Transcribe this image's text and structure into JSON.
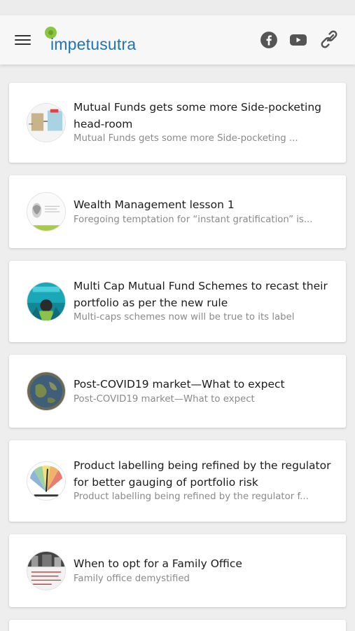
{
  "app": {
    "brand": "impetusutra",
    "icons": [
      "menu-icon",
      "facebook-icon",
      "youtube-icon",
      "link-icon"
    ],
    "brand_color": "#1f74b5",
    "logo_dot_color": "#8cc63f"
  },
  "articles": [
    {
      "title": "Mutual Funds gets some more Side-pocketing head-room",
      "summary": "Mutual Funds gets some more Side-pocketing ..."
    },
    {
      "title": "Wealth Management lesson 1",
      "summary": "Foregoing temptation for “instant gratification” is..."
    },
    {
      "title": "Multi Cap Mutual Fund Schemes to recast their portfolio as per the new rule",
      "summary": "Multi-caps schemes now will be true to its label"
    },
    {
      "title": " Post-COVID19 market—What to expect",
      "summary": "Post-COVID19 market—What to expect"
    },
    {
      "title": "Product labelling being refined by the regulator for better gauging of portfolio risk",
      "summary": "Product labelling being refined by the regulator f..."
    },
    {
      "title": "When to opt for a Family Office",
      "summary": "Family office demystified"
    }
  ]
}
